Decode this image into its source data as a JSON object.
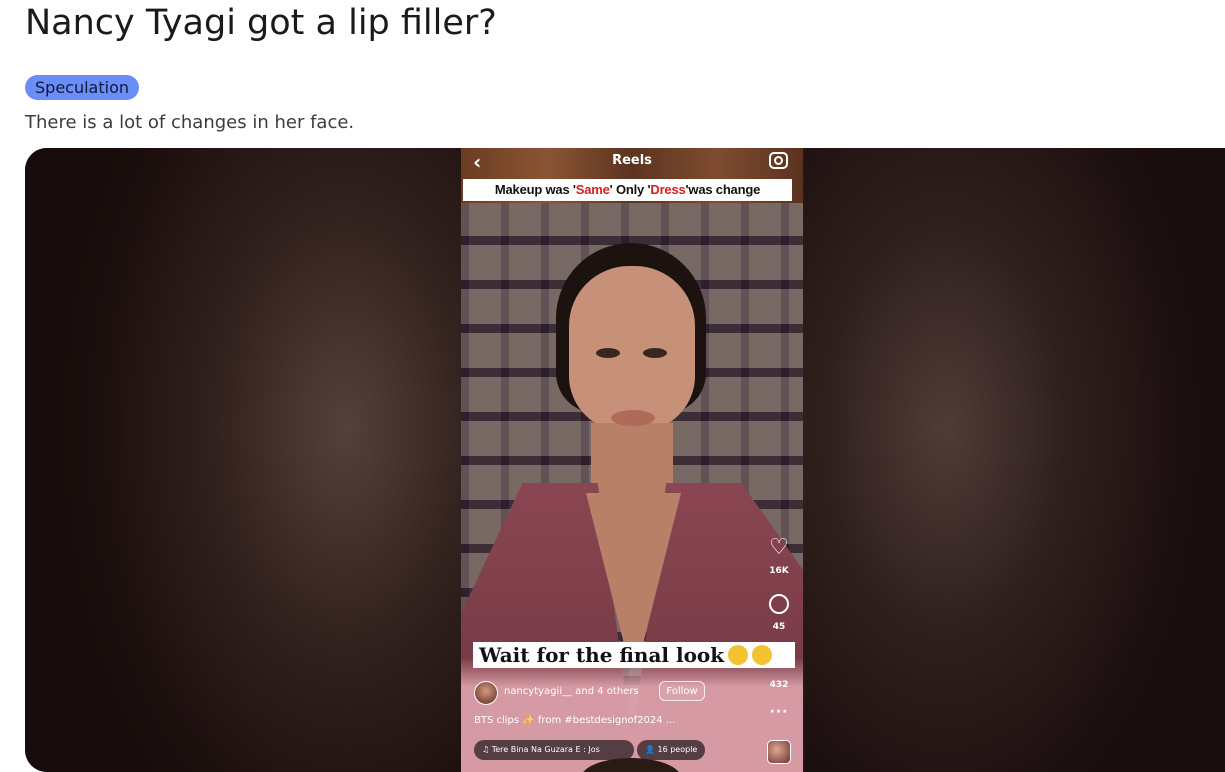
{
  "post": {
    "title": "Nancy Tyagi got a lip filler?",
    "flair": "Speculation",
    "body": "There is a lot of changes in her face."
  },
  "reel": {
    "header_title": "Reels",
    "top_caption": {
      "part1": "Makeup was '",
      "red1": "Same",
      "part2": "' Only '",
      "red2": "Dress",
      "part3": "'was change"
    },
    "overlay_caption": "Wait for the final look",
    "likes": "16K",
    "comments": "45",
    "shares": "432",
    "username_line": "nancytyagii__ and 4 others",
    "follow_label": "Follow",
    "description": "BTS clips ✨ from #bestdesignof2024 ...",
    "music": "♫  Tere Bina Na Guzara E : Jos",
    "people": "👤 16 people",
    "more": "···",
    "back_icon": "‹",
    "heart_icon": "♡"
  }
}
